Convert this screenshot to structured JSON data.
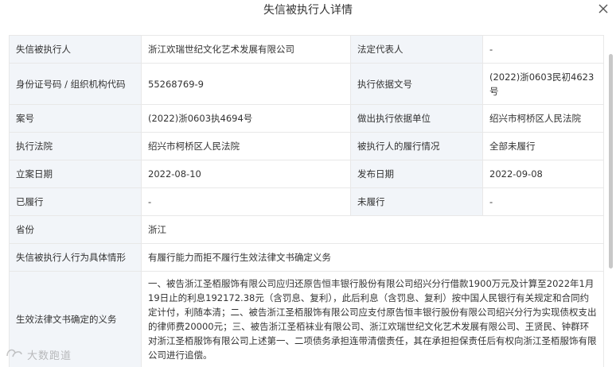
{
  "modal": {
    "title": "失信被执行人详情"
  },
  "rows": [
    {
      "l1": "失信被执行人",
      "v1": "浙江欢瑞世纪文化艺术发展有限公司",
      "l2": "法定代表人",
      "v2": "-"
    },
    {
      "l1": "身份证号码 / 组织机构代码",
      "v1": "55268769-9",
      "l2": "执行依据文号",
      "v2": "(2022)浙0603民初4623号"
    },
    {
      "l1": "案号",
      "v1": "(2022)浙0603执4694号",
      "l2": "做出执行依据单位",
      "v2": "绍兴市柯桥区人民法院"
    },
    {
      "l1": "执行法院",
      "v1": "绍兴市柯桥区人民法院",
      "l2": "被执行人的履行情况",
      "v2": "全部未履行"
    },
    {
      "l1": "立案日期",
      "v1": "2022-08-10",
      "l2": "发布日期",
      "v2": "2022-09-08"
    },
    {
      "l1": "已履行",
      "v1": "-",
      "l2": "未履行",
      "v2": "-"
    }
  ],
  "province": {
    "label": "省份",
    "value": "浙江"
  },
  "behavior": {
    "label": "失信被执行人行为具体情形",
    "value": "有履行能力而拒不履行生效法律文书确定义务"
  },
  "obligation": {
    "label": "生效法律文书确定的义务",
    "value": "一、被告浙江圣栢服饰有限公司应归还原告恒丰银行股份有限公司绍兴分行借款1900万元及计算至2022年1月19日止的利息192172.38元（含罚息、复利），此后利息（含罚息、复利）按中国人民银行有关规定和合同约定计付，利随本清；二、被告浙江圣栢服饰有限公司应支付原告恒丰银行股份有限公司绍兴分行为实现债权支出的律师费20000元；三、被告浙江圣栢袜业有限公司、浙江欢瑞世纪文化艺术发展有限公司、王贤民、钟群环对浙江圣栢服饰有限公司上述第一、二项债务承担连带清偿责任，其在承担担保责任后有权向浙江圣栢服饰有限公司进行追偿。"
  },
  "watermark": {
    "text": "大数跑道"
  }
}
